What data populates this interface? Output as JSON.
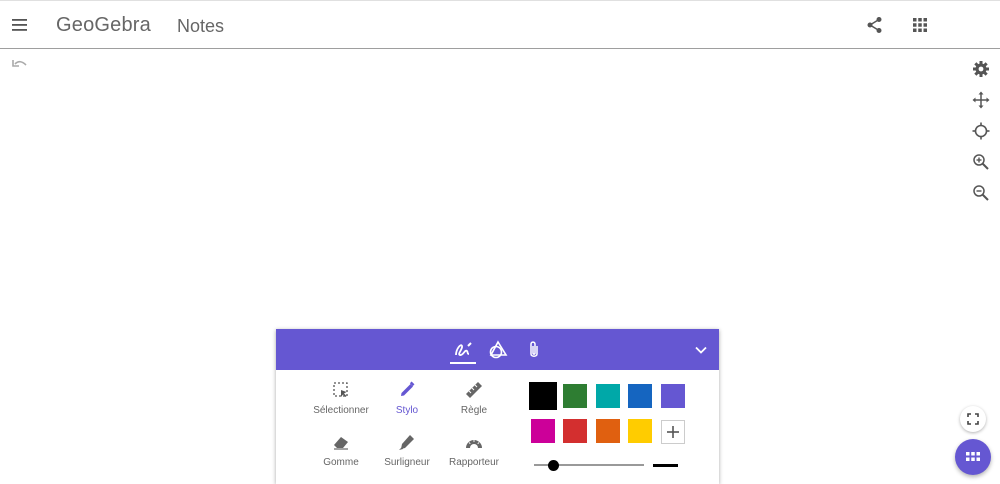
{
  "header": {
    "logo_text": "GeoGebra",
    "app_title": "Notes",
    "icons": {
      "menu": "menu-icon",
      "share": "share-icon",
      "apps": "apps-grid-icon"
    }
  },
  "canvas": {
    "undo_icon": "undo-icon",
    "side_tools": [
      "settings-icon",
      "move-icon",
      "crosshair-icon",
      "zoom-in-icon",
      "zoom-out-icon"
    ]
  },
  "toolbox": {
    "tabs": [
      {
        "name": "pen-tab",
        "icon": "pen-icon",
        "active": true
      },
      {
        "name": "shapes-tab",
        "icon": "shapes-icon",
        "active": false
      },
      {
        "name": "attach-tab",
        "icon": "paperclip-icon",
        "active": false
      }
    ],
    "collapse_icon": "chevron-down-icon",
    "tools": [
      {
        "label": "Sélectionner",
        "icon": "select-icon",
        "active": false
      },
      {
        "label": "Stylo",
        "icon": "pen-icon",
        "active": true
      },
      {
        "label": "Règle",
        "icon": "ruler-icon",
        "active": false
      },
      {
        "label": "Gomme",
        "icon": "eraser-icon",
        "active": false
      },
      {
        "label": "Surligneur",
        "icon": "highlighter-icon",
        "active": false
      },
      {
        "label": "Rapporteur",
        "icon": "protractor-icon",
        "active": false
      }
    ],
    "colors": {
      "selected": "#000000",
      "swatches": [
        "#000000",
        "#2e7d32",
        "#00a8a8",
        "#1565c0",
        "#6557d2",
        "#cc0099",
        "#d32f2f",
        "#e06010",
        "#ffcc00"
      ]
    },
    "add_color_icon": "plus-icon",
    "stroke_width": 0.1
  },
  "accent_color": "#6557d2"
}
